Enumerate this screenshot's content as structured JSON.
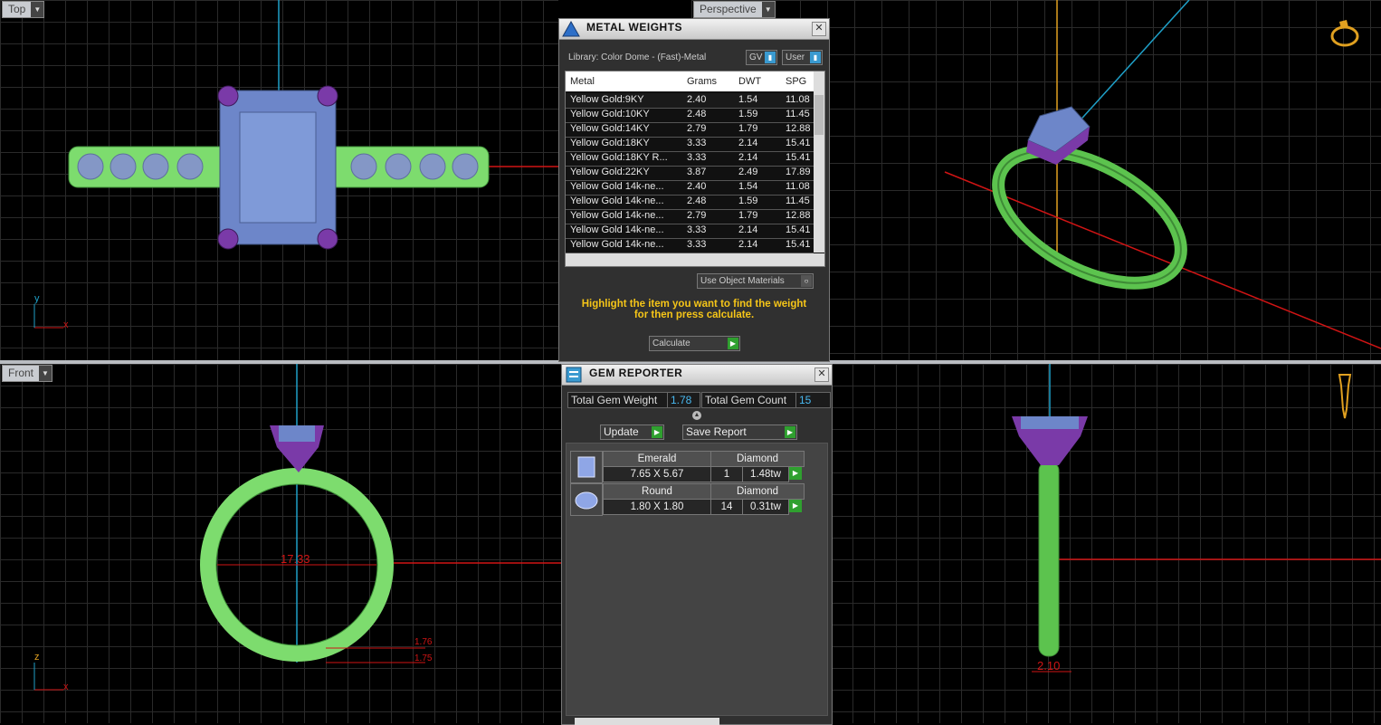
{
  "viewports": {
    "top": {
      "label": "Top"
    },
    "perspective": {
      "label": "Perspective"
    },
    "front": {
      "label": "Front"
    },
    "front_dimension": "17.33",
    "side_dimension": "2.10",
    "small_dims": [
      "1.76",
      "1.75"
    ],
    "axes": {
      "y": "y",
      "x": "x",
      "z": "z"
    }
  },
  "metal_weights": {
    "title": "METAL WEIGHTS",
    "library": "Library: Color Dome - (Fast)-Metal",
    "gv_label": "GV",
    "user_label": "User",
    "columns": [
      "Metal",
      "Grams",
      "DWT",
      "SPG"
    ],
    "rows": [
      [
        "Yellow Gold:9KY",
        "2.40",
        "1.54",
        "11.08"
      ],
      [
        "Yellow Gold:10KY",
        "2.48",
        "1.59",
        "11.45"
      ],
      [
        "Yellow Gold:14KY",
        "2.79",
        "1.79",
        "12.88"
      ],
      [
        "Yellow Gold:18KY",
        "3.33",
        "2.14",
        "15.41"
      ],
      [
        "Yellow Gold:18KY R...",
        "3.33",
        "2.14",
        "15.41"
      ],
      [
        "Yellow Gold:22KY",
        "3.87",
        "2.49",
        "17.89"
      ],
      [
        "Yellow Gold 14k-ne...",
        "2.40",
        "1.54",
        "11.08"
      ],
      [
        "Yellow Gold 14k-ne...",
        "2.48",
        "1.59",
        "11.45"
      ],
      [
        "Yellow Gold 14k-ne...",
        "2.79",
        "1.79",
        "12.88"
      ],
      [
        "Yellow Gold 14k-ne...",
        "3.33",
        "2.14",
        "15.41"
      ],
      [
        "Yellow Gold 14k-ne...",
        "3.33",
        "2.14",
        "15.41"
      ]
    ],
    "use_object_materials": "Use Object Materials",
    "hint": "Highlight the item you want to find the weight for then press calculate.",
    "calculate": "Calculate"
  },
  "gem_reporter": {
    "title": "GEM REPORTER",
    "total_weight_label": "Total Gem Weight",
    "total_weight": "1.78",
    "total_count_label": "Total Gem Count",
    "total_count": "15",
    "update": "Update",
    "save_report": "Save Report",
    "gems": [
      {
        "shape": "Emerald",
        "material": "Diamond",
        "size": "7.65 X 5.67",
        "count": "1",
        "weight": "1.48tw"
      },
      {
        "shape": "Round",
        "material": "Diamond",
        "size": "1.80 X 1.80",
        "count": "14",
        "weight": "0.31tw"
      }
    ]
  },
  "colors": {
    "band": "#7ddc6e",
    "stone": "#6d86c9",
    "prong": "#7a3aa8",
    "axis_red": "#d01414",
    "axis_blue": "#1fa0c8",
    "accent": "#f5c518"
  }
}
